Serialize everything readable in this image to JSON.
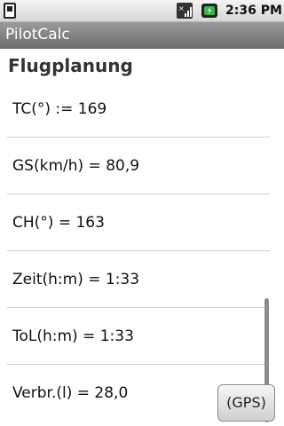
{
  "status_bar": {
    "time": "2:36 PM",
    "icons": [
      "sd-card-icon",
      "signal-icon",
      "battery-icon"
    ]
  },
  "app": {
    "title": "PilotCalc"
  },
  "section": {
    "title": "Flugplanung"
  },
  "rows": [
    {
      "label": "TC(°) := 169"
    },
    {
      "label": "GS(km/h) = 80,9"
    },
    {
      "label": "CH(°) = 163"
    },
    {
      "label": "Zeit(h:m) = 1:33"
    },
    {
      "label": "ToL(h:m) = 1:33"
    },
    {
      "label": "Verbr.(l) = 28,0"
    }
  ],
  "gps_button": {
    "label": "(GPS)"
  }
}
